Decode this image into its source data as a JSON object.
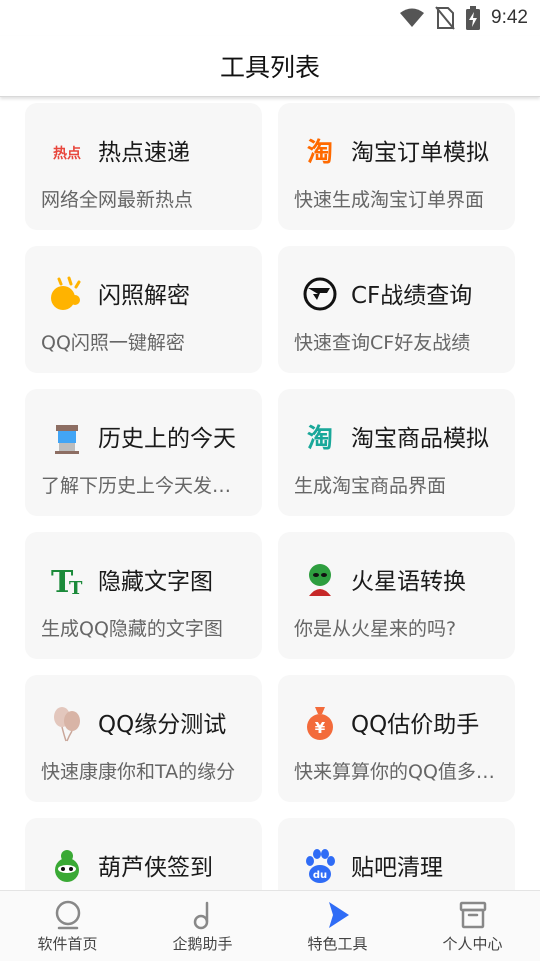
{
  "status_bar": {
    "time": "9:42"
  },
  "header": {
    "title": "工具列表"
  },
  "tools": [
    {
      "title": "热点速递",
      "desc": "网络全网最新热点",
      "icon": "hot-news-icon",
      "icon_text": "热点"
    },
    {
      "title": "淘宝订单模拟",
      "desc": "快速生成淘宝订单界面",
      "icon": "taobao-icon",
      "icon_text": "淘"
    },
    {
      "title": "闪照解密",
      "desc": "QQ闪照一键解密",
      "icon": "flash-photo-icon"
    },
    {
      "title": "CF战绩查询",
      "desc": "快速查询CF好友战绩",
      "icon": "cf-logo-icon"
    },
    {
      "title": "历史上的今天",
      "desc": "了解下历史上今天发生的事",
      "icon": "history-pillar-icon"
    },
    {
      "title": "淘宝商品模拟",
      "desc": "生成淘宝商品界面",
      "icon": "taobao-icon",
      "icon_text": "淘"
    },
    {
      "title": "隐藏文字图",
      "desc": "生成QQ隐藏的文字图",
      "icon": "hidden-text-icon",
      "icon_text": "T"
    },
    {
      "title": "火星语转换",
      "desc": "你是从火星来的吗?",
      "icon": "martian-icon"
    },
    {
      "title": "QQ缘分测试",
      "desc": "快速康康你和TA的缘分",
      "icon": "balloons-icon"
    },
    {
      "title": "QQ估价助手",
      "desc": "快来算算你的QQ值多少钱",
      "icon": "money-bag-icon",
      "icon_text": "¥"
    },
    {
      "title": "葫芦侠签到",
      "desc": "",
      "icon": "huluxia-icon"
    },
    {
      "title": "贴吧清理",
      "desc": "",
      "icon": "baidu-paw-icon",
      "icon_text": "du"
    }
  ],
  "bottom_nav": [
    {
      "label": "软件首页",
      "icon": "home-circle-icon"
    },
    {
      "label": "企鹅助手",
      "icon": "music-note-icon"
    },
    {
      "label": "特色工具",
      "icon": "play-arrow-icon",
      "active": true
    },
    {
      "label": "个人中心",
      "icon": "box-icon"
    }
  ],
  "colors": {
    "accent": "#2f6cf6",
    "card_bg": "#f7f7f7",
    "taobao_orange": "#ff6a00",
    "taobao_teal": "#1aa89a"
  }
}
